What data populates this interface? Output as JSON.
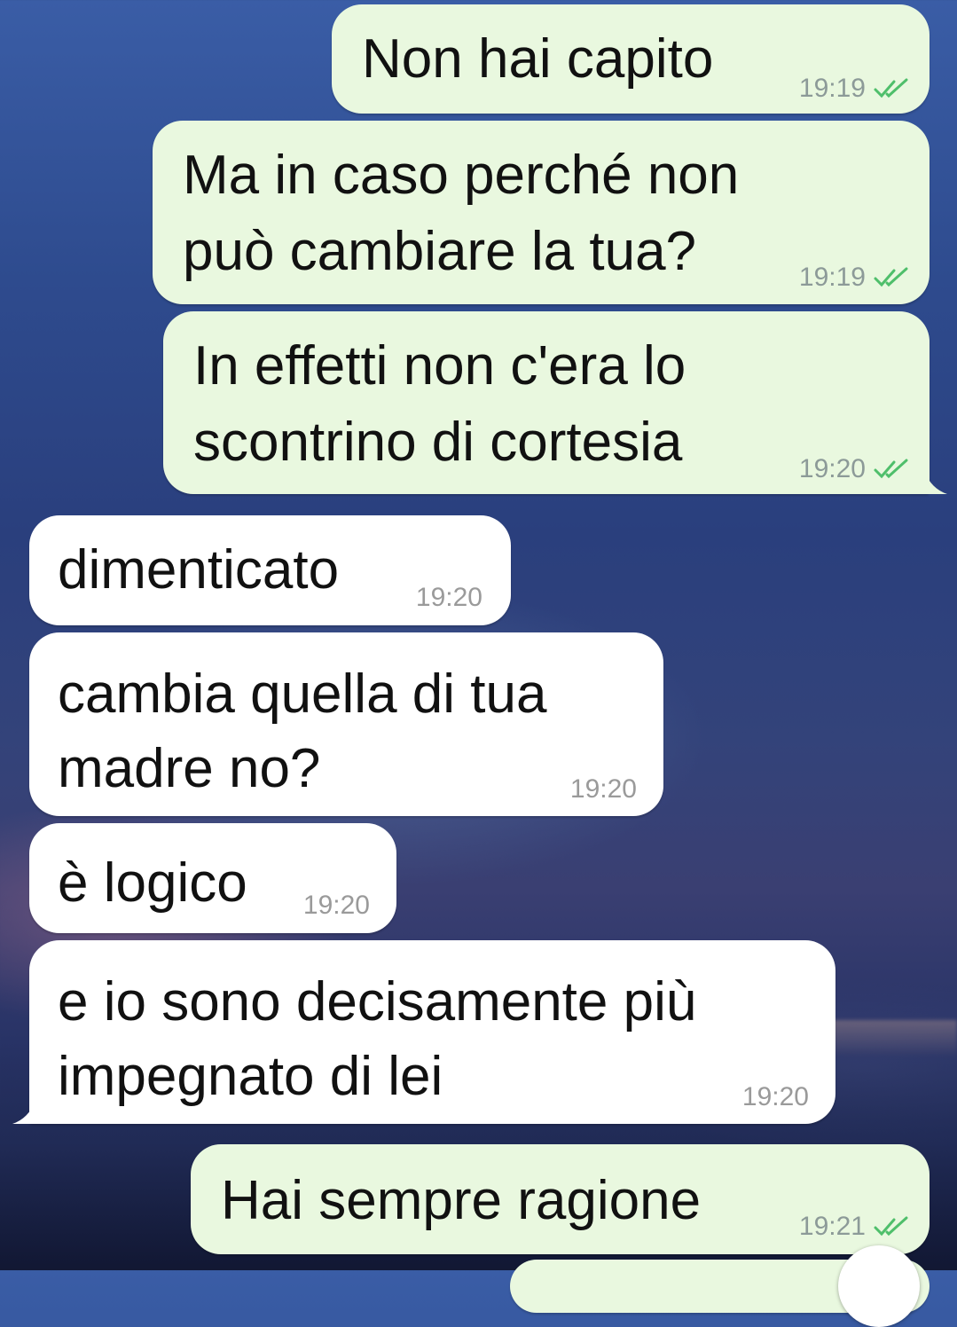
{
  "colors": {
    "outgoing_bubble": "#e9f8df",
    "incoming_bubble": "#ffffff",
    "read_ticks": "#4fbf6b",
    "timestamp": "#8c9a98"
  },
  "icons": {
    "read_receipt": "double-check-icon"
  },
  "messages": [
    {
      "direction": "outgoing",
      "lines": [
        "Non hai capito"
      ],
      "time": "19:19",
      "read": true
    },
    {
      "direction": "outgoing",
      "lines": [
        "Ma in caso perché non",
        "può cambiare la tua?"
      ],
      "time": "19:19",
      "read": true
    },
    {
      "direction": "outgoing",
      "lines": [
        "In effetti non c'era lo",
        "scontrino di cortesia"
      ],
      "time": "19:20",
      "read": true
    },
    {
      "direction": "incoming",
      "lines": [
        "dimenticato"
      ],
      "time": "19:20"
    },
    {
      "direction": "incoming",
      "lines": [
        "cambia quella di tua",
        "madre no?"
      ],
      "time": "19:20"
    },
    {
      "direction": "incoming",
      "lines": [
        "è logico"
      ],
      "time": "19:20"
    },
    {
      "direction": "incoming",
      "lines": [
        "e io sono decisamente più",
        "impegnato di lei"
      ],
      "time": "19:20"
    },
    {
      "direction": "outgoing",
      "lines": [
        "Hai sempre ragione"
      ],
      "time": "19:21",
      "read": true
    }
  ]
}
